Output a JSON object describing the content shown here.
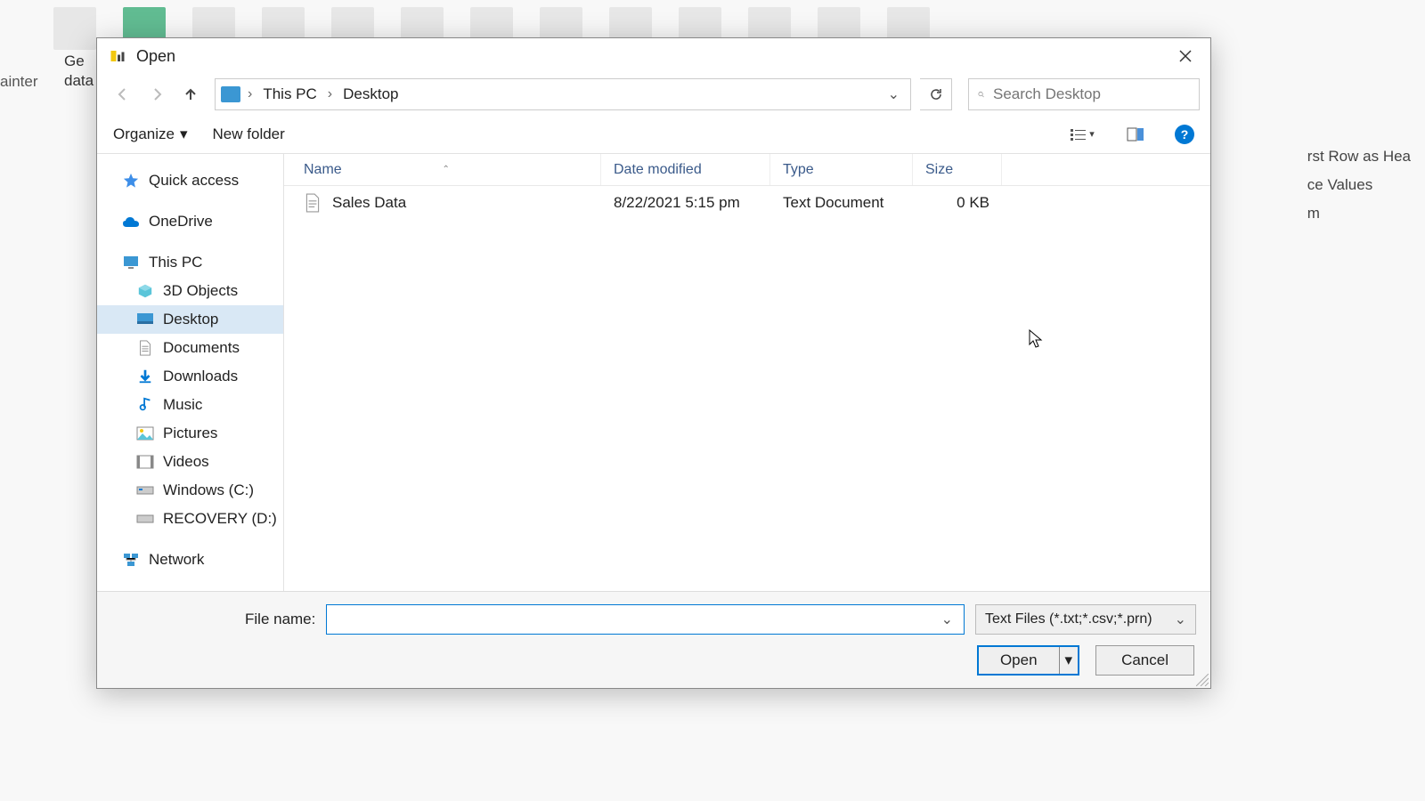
{
  "bg": {
    "get_data_line1": "Ge",
    "get_data_line2": "data",
    "painter": "ainter",
    "side_lines": [
      "rst Row as Hea",
      "ce Values",
      "m"
    ]
  },
  "dialog": {
    "title": "Open",
    "breadcrumb": {
      "root": "This PC",
      "leaf": "Desktop"
    },
    "search_placeholder": "Search Desktop",
    "toolbar": {
      "organize": "Organize",
      "new_folder": "New folder"
    },
    "tree": {
      "quick_access": "Quick access",
      "onedrive": "OneDrive",
      "this_pc": "This PC",
      "objects3d": "3D Objects",
      "desktop": "Desktop",
      "documents": "Documents",
      "downloads": "Downloads",
      "music": "Music",
      "pictures": "Pictures",
      "videos": "Videos",
      "drive_c": "Windows (C:)",
      "drive_d": "RECOVERY (D:)",
      "network": "Network"
    },
    "columns": {
      "name": "Name",
      "date": "Date modified",
      "type": "Type",
      "size": "Size"
    },
    "files": [
      {
        "name": "Sales Data",
        "date": "8/22/2021 5:15 pm",
        "type": "Text Document",
        "size": "0 KB"
      }
    ],
    "footer": {
      "file_name_label": "File name:",
      "file_name_value": "",
      "filter": "Text Files (*.txt;*.csv;*.prn)",
      "open": "Open",
      "cancel": "Cancel"
    }
  }
}
